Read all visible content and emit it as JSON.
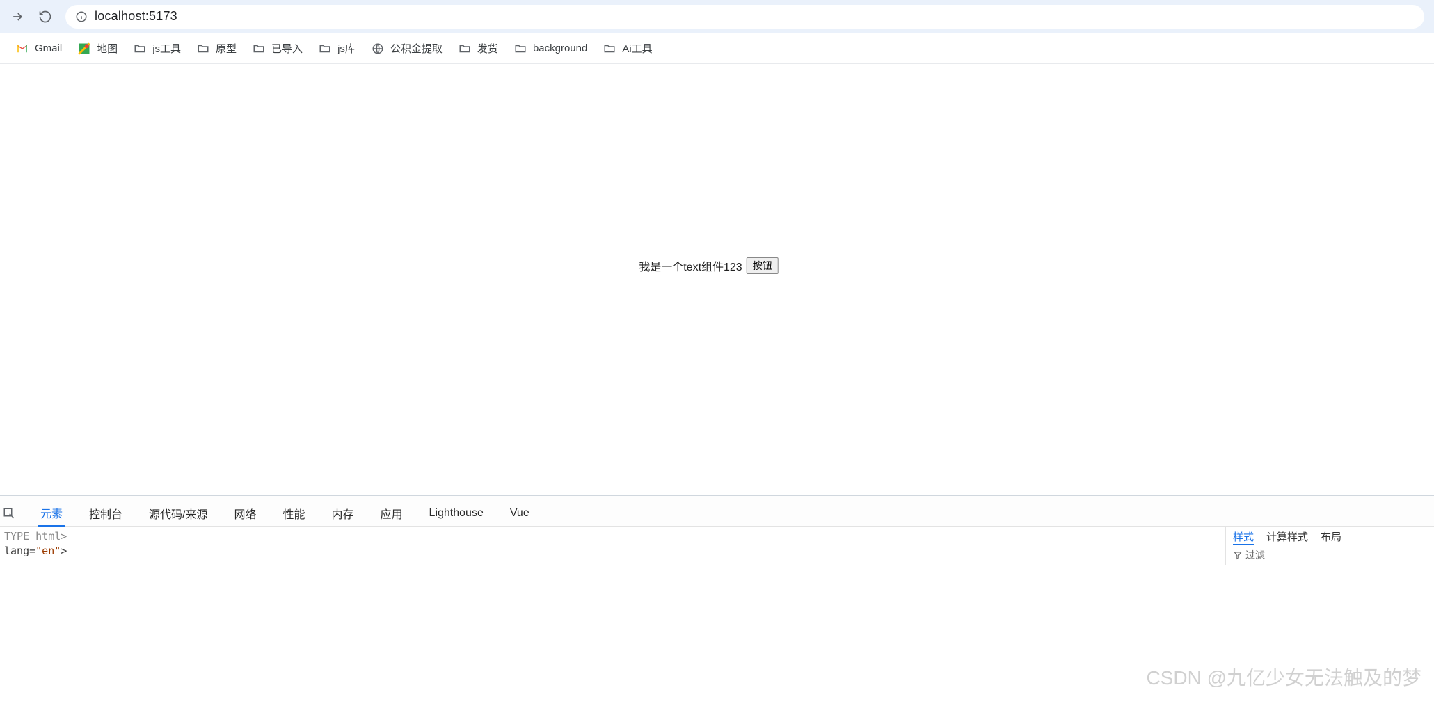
{
  "browser": {
    "url": "localhost:5173"
  },
  "bookmarks": [
    {
      "kind": "gmail",
      "label": "Gmail"
    },
    {
      "kind": "maps",
      "label": "地图"
    },
    {
      "kind": "folder",
      "label": "js工具"
    },
    {
      "kind": "folder",
      "label": "原型"
    },
    {
      "kind": "folder",
      "label": "已导入"
    },
    {
      "kind": "folder",
      "label": "js库"
    },
    {
      "kind": "globe",
      "label": "公积金提取"
    },
    {
      "kind": "folder",
      "label": "发货"
    },
    {
      "kind": "folder",
      "label": "background"
    },
    {
      "kind": "folder",
      "label": "Ai工具"
    }
  ],
  "page": {
    "text_component": "我是一个text组件123",
    "button_label": "按钮"
  },
  "devtools": {
    "tabs": [
      "元素",
      "控制台",
      "源代码/来源",
      "网络",
      "性能",
      "内存",
      "应用",
      "Lighthouse",
      "Vue"
    ],
    "active_tab": "元素",
    "source_lines": {
      "line1": "TYPE html>",
      "line2_prefix": " lang=",
      "line2_value": "\"en\"",
      "line2_suffix": ">"
    },
    "styles": {
      "tabs": [
        "样式",
        "计算样式",
        "布局"
      ],
      "active_tab": "样式",
      "filter_label": "过滤"
    }
  },
  "watermark": "CSDN @九亿少女无法触及的梦"
}
